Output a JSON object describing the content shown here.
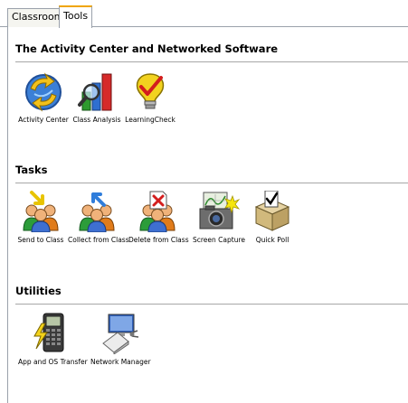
{
  "tabs": [
    {
      "label": "Classroom",
      "active": false
    },
    {
      "label": "Tools",
      "active": true
    }
  ],
  "sections": {
    "activity": {
      "title": "The Activity Center and Networked Software",
      "items": [
        {
          "label": "Activity Center",
          "icon": "activity-center-icon"
        },
        {
          "label": "Class Analysis",
          "icon": "class-analysis-icon"
        },
        {
          "label": "LearningCheck",
          "icon": "learningcheck-icon"
        }
      ]
    },
    "tasks": {
      "title": "Tasks",
      "items": [
        {
          "label": "Send to Class",
          "icon": "send-to-class-icon"
        },
        {
          "label": "Collect from Class",
          "icon": "collect-from-class-icon"
        },
        {
          "label": "Delete from Class",
          "icon": "delete-from-class-icon"
        },
        {
          "label": "Screen Capture",
          "icon": "screen-capture-icon"
        },
        {
          "label": "Quick Poll",
          "icon": "quick-poll-icon"
        }
      ]
    },
    "utilities": {
      "title": "Utilities",
      "items": [
        {
          "label": "App and OS Transfer",
          "icon": "app-os-transfer-icon"
        },
        {
          "label": "Network Manager",
          "icon": "network-manager-icon"
        }
      ]
    }
  },
  "colors": {
    "tab_accent": "#f0a500",
    "rule": "#a7a7a7"
  }
}
